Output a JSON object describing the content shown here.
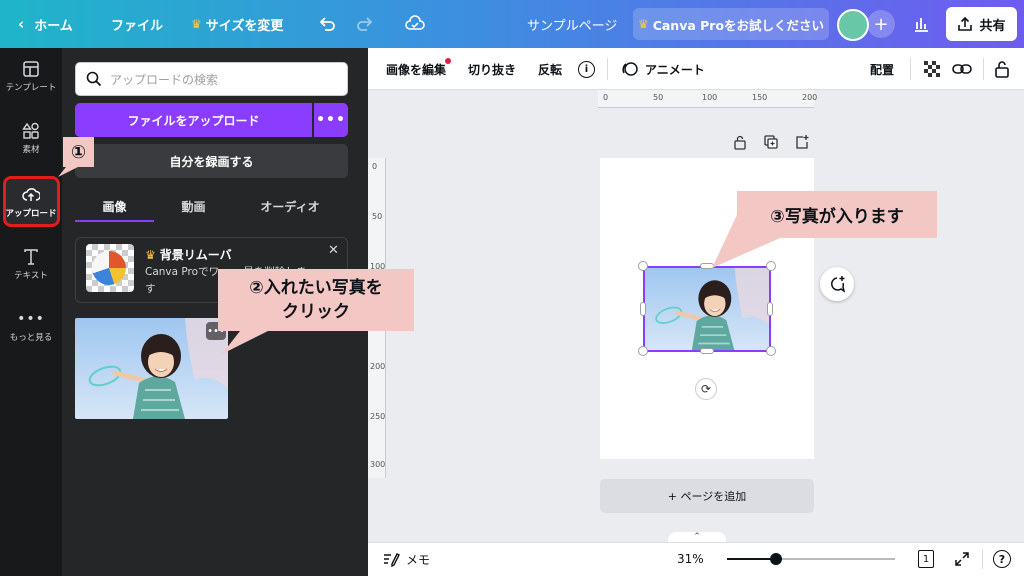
{
  "topbar": {
    "home": "ホーム",
    "file": "ファイル",
    "resize": "サイズを変更",
    "doc_title": "サンプルページ",
    "pro_cta": "Canva Proをお試しください",
    "share": "共有"
  },
  "rail": {
    "templates": "テンプレート",
    "elements": "素材",
    "uploads": "アップロード",
    "text": "テキスト",
    "more": "もっと見る"
  },
  "panel": {
    "search_placeholder": "アップロードの検索",
    "upload_button": "ファイルをアップロード",
    "more": "•••",
    "record_button": "自分を録画する",
    "tabs": [
      "画像",
      "動画",
      "オーディオ"
    ],
    "promo_title": "背景リムーバ",
    "promo_text": "Canva Proでワ… …景を削除します",
    "thumb_more": "•••"
  },
  "editor": {
    "edit_image": "画像を編集",
    "crop": "切り抜き",
    "flip": "反転",
    "info": "i",
    "animate": "アニメート",
    "position": "配置",
    "add_page": "+ ページを追加"
  },
  "rulers": {
    "h_ticks": [
      "0",
      "50",
      "100",
      "150",
      "200"
    ],
    "v_ticks": [
      "0",
      "50",
      "100",
      "150",
      "200",
      "250",
      "300"
    ]
  },
  "bottombar": {
    "notes": "メモ",
    "zoom": "31%",
    "zoom_level": 0.29,
    "page_number": "1",
    "help": "?"
  },
  "annotations": {
    "step1": "①",
    "step2_line1": "②入れたい写真を",
    "step2_line2": "クリック",
    "step3": "③写真が入ります"
  },
  "colors": {
    "accent": "#8b3dff",
    "highlight": "#e11d1d",
    "annotation_bg": "#f2c7c4"
  }
}
